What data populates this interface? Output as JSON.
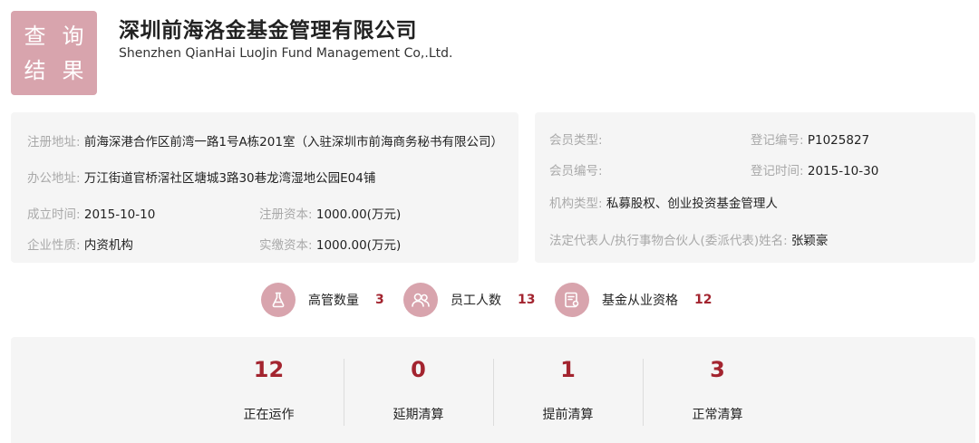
{
  "header": {
    "badge_chars": [
      "查",
      "询",
      "结",
      "果"
    ],
    "company_name": "深圳前海洛金基金管理有限公司",
    "company_name_en": "Shenzhen QianHai LuoJin Fund Management Co,.Ltd."
  },
  "basic_info": {
    "reg_address_label": "注册地址:",
    "reg_address": "前海深港合作区前湾一路1号A栋201室（入驻深圳市前海商务秘书有限公司）",
    "office_address_label": "办公地址:",
    "office_address": "万江街道官桥滘社区塘城3路30巷龙湾湿地公园E04铺",
    "founded_label": "成立时间:",
    "founded": "2015-10-10",
    "reg_capital_label": "注册资本:",
    "reg_capital": "1000.00(万元)",
    "nature_label": "企业性质:",
    "nature": "内资机构",
    "paid_capital_label": "实缴资本:",
    "paid_capital": "1000.00(万元)"
  },
  "member_info": {
    "member_type_label": "会员类型:",
    "member_type": "",
    "reg_no_label": "登记编号:",
    "reg_no": "P1025827",
    "member_no_label": "会员编号:",
    "member_no": "",
    "reg_time_label": "登记时间:",
    "reg_time": "2015-10-30",
    "org_type_label": "机构类型:",
    "org_type": "私募股权、创业投资基金管理人",
    "legal_rep_label": "法定代表人/执行事物合伙人(委派代表)姓名:",
    "legal_rep": "张颖豪"
  },
  "counts": [
    {
      "label": "高管数量",
      "value": "3",
      "icon": "flask-icon"
    },
    {
      "label": "员工人数",
      "value": "13",
      "icon": "people-icon"
    },
    {
      "label": "基金从业资格",
      "value": "12",
      "icon": "certificate-icon"
    }
  ],
  "fund_stats": [
    {
      "value": "12",
      "label": "正在运作"
    },
    {
      "value": "0",
      "label": "延期清算"
    },
    {
      "value": "1",
      "label": "提前清算"
    },
    {
      "value": "3",
      "label": "正常清算"
    }
  ],
  "colors": {
    "accent": "#d8a4ad",
    "number_red": "#a3242f",
    "panel_bg": "#f5f5f5",
    "label_gray": "#a9a9a9"
  }
}
